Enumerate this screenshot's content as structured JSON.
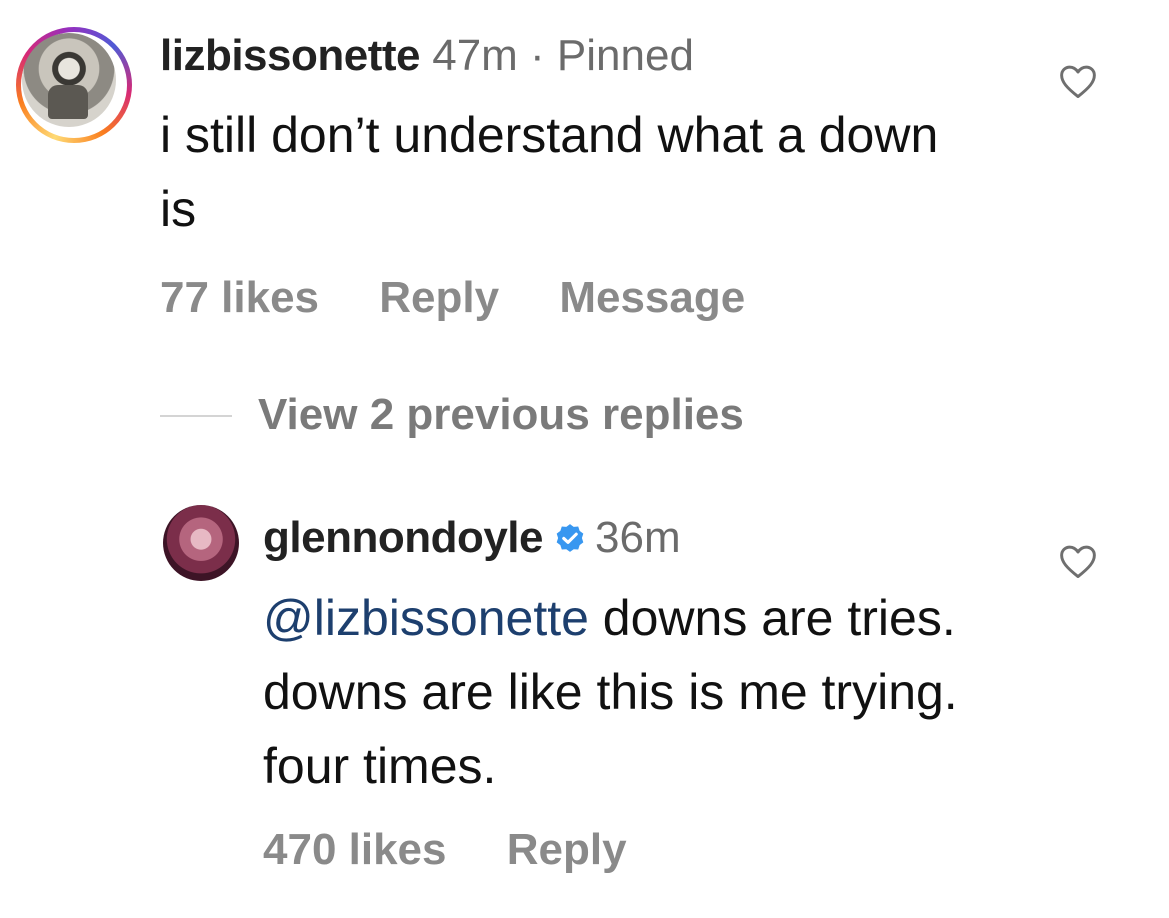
{
  "comments": [
    {
      "username": "lizbissonette",
      "meta": "47m · Pinned",
      "text": "i still don’t understand what a down is",
      "likes": "77 likes",
      "reply_label": "Reply",
      "message_label": "Message",
      "avatar_icon": "user-avatar-photo",
      "like_icon": "heart-icon"
    },
    {
      "username": "glennondoyle",
      "verified_icon": "verified-badge-icon",
      "meta": "36m",
      "mention": "@lizbissonette",
      "text": " downs are tries. downs are like this is me trying. four times.",
      "likes": "470 likes",
      "reply_label": "Reply",
      "avatar_icon": "user-avatar-photo",
      "like_icon": "heart-icon"
    }
  ],
  "view_replies_label": "View 2 previous replies",
  "colors": {
    "mention": "#1d3f6e",
    "verified": "#3897f0",
    "muted": "#8a8a8a"
  }
}
